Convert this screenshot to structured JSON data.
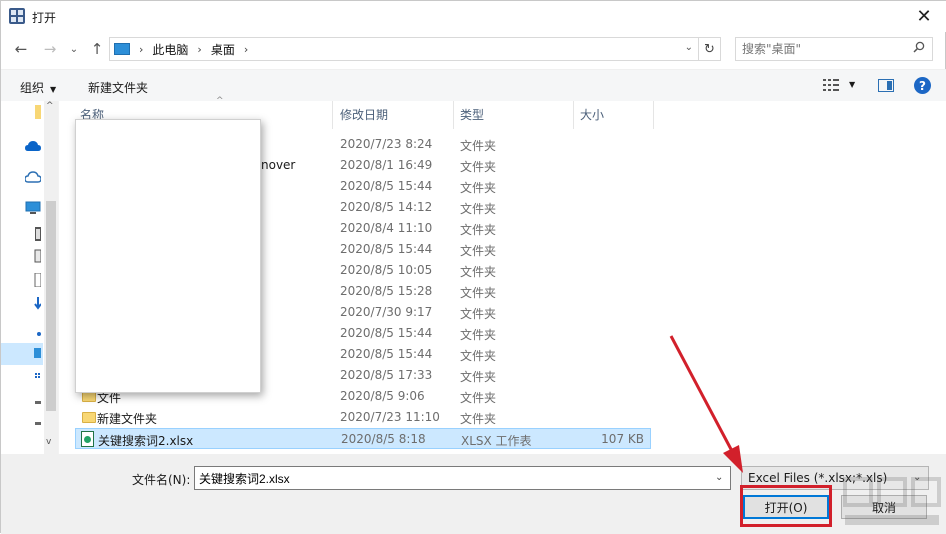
{
  "window": {
    "title": "打开",
    "close": "✕"
  },
  "nav": {
    "back": "←",
    "forward": "→",
    "recent": "⌄",
    "up": "↑",
    "breadcrumb": [
      "此电脑",
      "桌面"
    ],
    "refresh": "↻",
    "search_placeholder": "搜索\"桌面\""
  },
  "toolbar": {
    "organize": "组织",
    "new_folder": "新建文件夹",
    "help": "?"
  },
  "columns": {
    "name": "名称",
    "date": "修改日期",
    "type": "类型",
    "size": "大小"
  },
  "rows": [
    {
      "name": "",
      "date": "2020/7/23 8:24",
      "type": "文件夹",
      "size": ""
    },
    {
      "name": "",
      "date": "2020/8/1 16:49",
      "type": "文件夹",
      "size": ""
    },
    {
      "name": "",
      "date": "2020/8/5 15:44",
      "type": "文件夹",
      "size": ""
    },
    {
      "name": "",
      "date": "2020/8/5 14:12",
      "type": "文件夹",
      "size": ""
    },
    {
      "name": "",
      "date": "2020/8/4 11:10",
      "type": "文件夹",
      "size": ""
    },
    {
      "name": "",
      "date": "2020/8/5 15:44",
      "type": "文件夹",
      "size": ""
    },
    {
      "name": "",
      "date": "2020/8/5 10:05",
      "type": "文件夹",
      "size": ""
    },
    {
      "name": "",
      "date": "2020/8/5 15:28",
      "type": "文件夹",
      "size": ""
    },
    {
      "name": "",
      "date": "2020/7/30 9:17",
      "type": "文件夹",
      "size": ""
    },
    {
      "name": "",
      "date": "2020/8/5 15:44",
      "type": "文件夹",
      "size": ""
    },
    {
      "name": "",
      "date": "2020/8/5 15:44",
      "type": "文件夹",
      "size": ""
    },
    {
      "name": "",
      "date": "2020/8/5 17:33",
      "type": "文件夹",
      "size": ""
    },
    {
      "name": "文件",
      "date": "2020/8/5 9:06",
      "type": "文件夹",
      "size": ""
    },
    {
      "name": "新建文件夹",
      "date": "2020/7/23 11:10",
      "type": "文件夹",
      "size": ""
    },
    {
      "name": "关键搜索词2.xlsx",
      "date": "2020/8/5 8:18",
      "type": "XLSX 工作表",
      "size": "107 KB"
    }
  ],
  "partial_name_text": "nover",
  "bottom": {
    "filename_label": "文件名(N):",
    "filename_value": "关键搜索词2.xlsx",
    "filter": "Excel Files (*.xlsx;*.xls)",
    "open": "打开(O)",
    "cancel": "取消"
  },
  "colors": {
    "selection": "#cce8ff",
    "accent": "#0078d7",
    "annotation_red": "#d2202b"
  }
}
